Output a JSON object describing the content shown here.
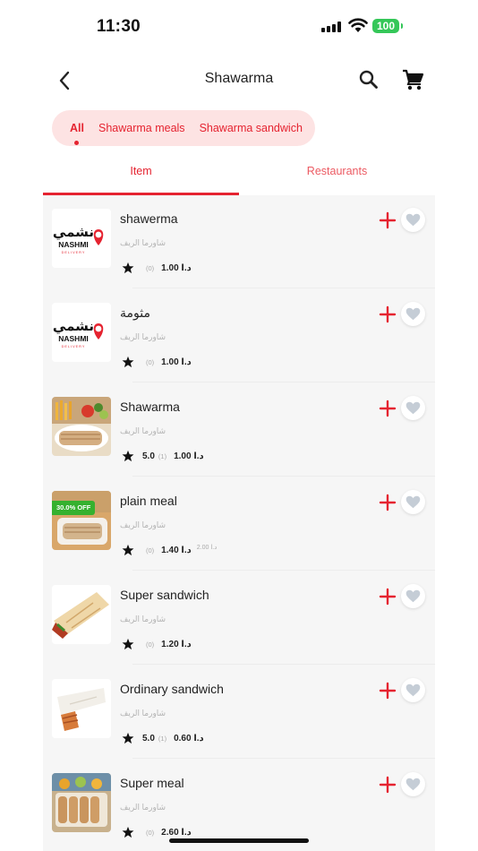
{
  "status": {
    "time": "11:30",
    "battery": "100"
  },
  "header": {
    "title": "Shawarma"
  },
  "chips": [
    {
      "label": "All",
      "active": true
    },
    {
      "label": "Shawarma meals",
      "active": false
    },
    {
      "label": "Shawarma sandwich",
      "active": false
    }
  ],
  "tabs": [
    {
      "label": "Item",
      "active": true
    },
    {
      "label": "Restaurants",
      "active": false
    }
  ],
  "items": [
    {
      "name": "shawerma",
      "restaurant": "شاورما الريف",
      "rating": "",
      "count": "(0)",
      "price": "1.00 د.ا",
      "old_price": "",
      "discount": "",
      "image": "nashmi-logo"
    },
    {
      "name": "مثومة",
      "restaurant": "شاورما الريف",
      "rating": "",
      "count": "(0)",
      "price": "1.00 د.ا",
      "old_price": "",
      "discount": "",
      "image": "nashmi-logo"
    },
    {
      "name": "Shawarma",
      "restaurant": "شاورما الريف",
      "rating": "5.0",
      "count": "(1)",
      "price": "1.00 د.ا",
      "old_price": "",
      "discount": "",
      "image": "shawarma-platter"
    },
    {
      "name": "plain meal",
      "restaurant": "شاورما الريف",
      "rating": "",
      "count": "(0)",
      "price": "1.40 د.ا",
      "old_price": "2.00 د.ا",
      "discount": "30.0% OFF",
      "image": "plain-meal"
    },
    {
      "name": "Super sandwich",
      "restaurant": "شاورما الريف",
      "rating": "",
      "count": "(0)",
      "price": "1.20 د.ا",
      "old_price": "",
      "discount": "",
      "image": "wrap"
    },
    {
      "name": "Ordinary sandwich",
      "restaurant": "شاورما الريف",
      "rating": "5.0",
      "count": "(1)",
      "price": "0.60 د.ا",
      "old_price": "",
      "discount": "",
      "image": "wrap-small"
    },
    {
      "name": "Super meal",
      "restaurant": "شاورما الريف",
      "rating": "",
      "count": "(0)",
      "price": "2.60 د.ا",
      "old_price": "",
      "discount": "",
      "image": "meal-tray"
    }
  ],
  "logo_text": {
    "ar": "نشمي",
    "en": "NASHMI",
    "sub": "DELIVERY"
  },
  "colors": {
    "accent": "#e52330",
    "chip_bg": "#fde3e3",
    "list_bg": "#f6f6f6",
    "heart": "#c5cdd6",
    "badge": "#35b12f"
  }
}
